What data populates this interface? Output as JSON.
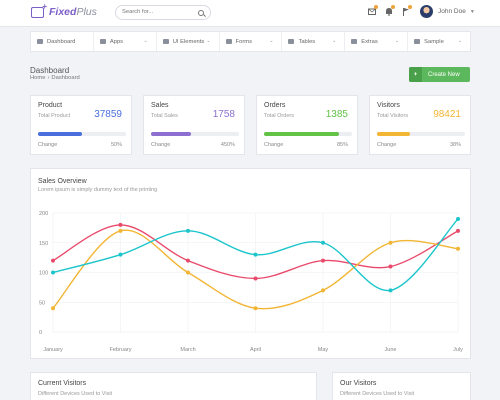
{
  "header": {
    "logo_bold": "Fixed",
    "logo_thin": "Plus",
    "search_placeholder": "Search for...",
    "user_name": "John Doe"
  },
  "nav": [
    {
      "label": "Dashboard",
      "icon": "home-icon",
      "has_caret": false
    },
    {
      "label": "Apps",
      "icon": "globe-icon",
      "has_caret": true
    },
    {
      "label": "UI Elements",
      "icon": "cogs-icon",
      "has_caret": true
    },
    {
      "label": "Forms",
      "icon": "file-icon",
      "has_caret": true
    },
    {
      "label": "Tables",
      "icon": "table-icon",
      "has_caret": true
    },
    {
      "label": "Extras",
      "icon": "grid-icon",
      "has_caret": true
    },
    {
      "label": "Sample",
      "icon": "folder-icon",
      "has_caret": true
    }
  ],
  "page": {
    "title": "Dashboard",
    "breadcrumb": [
      "Home",
      "Dashboard"
    ],
    "create_button": "Create New"
  },
  "stats": [
    {
      "title": "Product",
      "subtitle": "Total Product",
      "value": "37859",
      "color": "#4a6fdc",
      "progress": 0.5,
      "change_label": "Change",
      "change": "50%"
    },
    {
      "title": "Sales",
      "subtitle": "Total Sales",
      "value": "1758",
      "color": "#8c6fd1",
      "progress": 0.45,
      "change_label": "Change",
      "change": "450%"
    },
    {
      "title": "Orders",
      "subtitle": "Total Orders",
      "value": "1385",
      "color": "#62c346",
      "progress": 0.85,
      "change_label": "Change",
      "change": "85%"
    },
    {
      "title": "Visitors",
      "subtitle": "Total Visitors",
      "value": "98421",
      "color": "#f2b534",
      "progress": 0.38,
      "change_label": "Change",
      "change": "38%"
    }
  ],
  "sales_overview": {
    "title": "Sales Overview",
    "subtitle": "Lorem ipsum is simply dummy text of the printing"
  },
  "chart_data": {
    "type": "line",
    "categories": [
      "January",
      "February",
      "March",
      "April",
      "May",
      "June",
      "July"
    ],
    "ylim": [
      0,
      200
    ],
    "yticks": [
      0,
      50,
      100,
      150,
      200
    ],
    "grid": true,
    "series": [
      {
        "color": "#e94a6b",
        "values": [
          120,
          180,
          120,
          90,
          120,
          110,
          170
        ]
      },
      {
        "color": "#f2b534",
        "values": [
          40,
          170,
          100,
          40,
          70,
          150,
          140
        ]
      },
      {
        "color": "#1cc5cc",
        "values": [
          100,
          130,
          170,
          130,
          150,
          70,
          190
        ]
      }
    ]
  },
  "bottom": [
    {
      "title": "Current Visitors",
      "subtitle": "Different Devices Used to Visit"
    },
    {
      "title": "Our Visitors",
      "subtitle": "Different Devices Used to Visit"
    }
  ]
}
